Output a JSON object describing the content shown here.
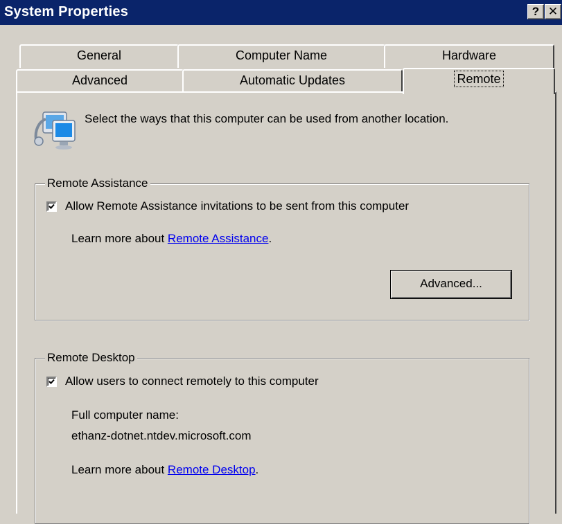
{
  "window": {
    "title": "System Properties",
    "help_label": "?",
    "close_label": "✕"
  },
  "tabs": {
    "row_back": [
      "General",
      "Computer Name",
      "Hardware"
    ],
    "row_front": [
      "Advanced",
      "Automatic Updates",
      "Remote"
    ],
    "active": "Remote"
  },
  "intro": {
    "icon": "remote-computer-icon",
    "text": "Select the ways that this computer can be used from another location."
  },
  "remote_assistance": {
    "legend": "Remote Assistance",
    "checkbox_label": "Allow Remote Assistance invitations to be sent from this computer",
    "checked": true,
    "learn_prefix": "Learn more about ",
    "learn_link": "Remote Assistance",
    "learn_suffix": ".",
    "advanced_button": "Advanced..."
  },
  "remote_desktop": {
    "legend": "Remote Desktop",
    "checkbox_label": "Allow users to connect remotely to this computer",
    "checked": true,
    "full_name_label": "Full computer name:",
    "full_name_value": "ethanz-dotnet.ntdev.microsoft.com",
    "learn_prefix": "Learn more about ",
    "learn_link": "Remote Desktop",
    "learn_suffix": "."
  },
  "colors": {
    "titlebar": "#0a246a",
    "face": "#d4d0c8",
    "link": "#0000ee"
  }
}
